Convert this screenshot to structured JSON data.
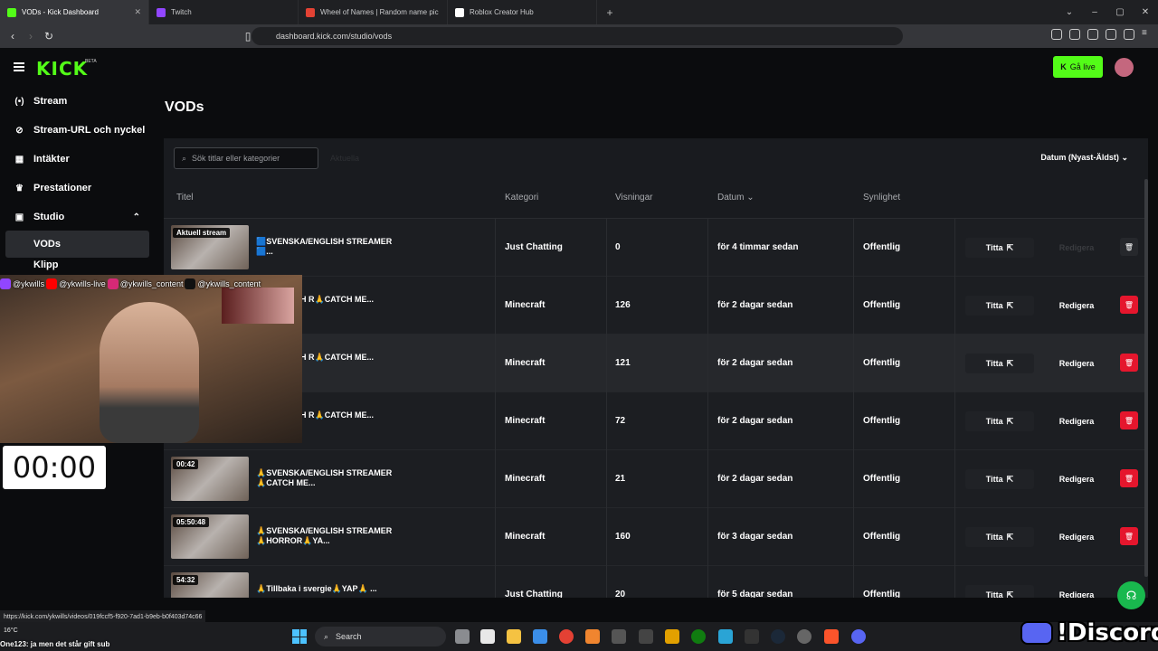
{
  "browser": {
    "tabs": [
      {
        "title": "VODs - Kick Dashboard",
        "active": true,
        "favicon_color": "#53fc18"
      },
      {
        "title": "Twitch",
        "active": false,
        "favicon_color": "#9146ff"
      },
      {
        "title": "Wheel of Names | Random name pic",
        "active": false,
        "favicon_color": "#e34234"
      },
      {
        "title": "Roblox Creator Hub",
        "active": false,
        "favicon_color": "#ffffff"
      }
    ],
    "close_glyph": "✕",
    "url": "dashboard.kick.com/studio/vods",
    "status_url": "https://kick.com/ykwills/videos/019fccf5-f920-7ad1-b9eb-b0f403d74c66"
  },
  "header": {
    "logo": "KICK",
    "beta": "BETA",
    "go_live_label": "Gå live",
    "accent_color": "#53fc18"
  },
  "sidebar": {
    "items": [
      {
        "label": "Stream",
        "icon": "broadcast-icon",
        "glyph": "(•)"
      },
      {
        "label": "Stream-URL och nyckel",
        "icon": "link-icon",
        "glyph": "⊘"
      },
      {
        "label": "Intäkter",
        "icon": "table-icon",
        "glyph": "▦"
      },
      {
        "label": "Prestationer",
        "icon": "trophy-icon",
        "glyph": "♛"
      },
      {
        "label": "Studio",
        "icon": "studio-icon",
        "glyph": "▣"
      },
      {
        "label": "VODs",
        "icon": "",
        "glyph": ""
      },
      {
        "label": "Klipp",
        "icon": "",
        "glyph": ""
      }
    ],
    "studio_chevron": "⌃"
  },
  "main": {
    "title": "VODs",
    "search_placeholder": "Sök titlar eller kategorier",
    "ghost_filter": "Aktuella",
    "sort_label": "Datum (Nyast-Äldst)",
    "columns": {
      "title": "Titel",
      "category": "Kategori",
      "views": "Visningar",
      "date": "Datum",
      "visibility": "Synlighet"
    },
    "watch_label": "Titta",
    "edit_label": "Redigera",
    "rows": [
      {
        "thumb_badge": "Aktuell stream",
        "title": "🟦SVENSKA/ENGLISH STREAMER🟦...",
        "category": "Just Chatting",
        "views": "0",
        "date": "för 4 timmar sedan",
        "visibility": "Offentlig",
        "editable": false
      },
      {
        "thumb_badge": "",
        "title": "KA/ENGLISH R🙏CATCH ME...",
        "category": "Minecraft",
        "views": "126",
        "date": "för 2 dagar sedan",
        "visibility": "Offentlig",
        "editable": true
      },
      {
        "thumb_badge": "",
        "title": "KA/ENGLISH R🙏CATCH ME...",
        "category": "Minecraft",
        "views": "121",
        "date": "för 2 dagar sedan",
        "visibility": "Offentlig",
        "editable": true
      },
      {
        "thumb_badge": "",
        "title": "KA/ENGLISH R🙏CATCH ME...",
        "category": "Minecraft",
        "views": "72",
        "date": "för 2 dagar sedan",
        "visibility": "Offentlig",
        "editable": true
      },
      {
        "thumb_badge": "00:42",
        "title": "🙏SVENSKA/ENGLISH STREAMER🙏CATCH ME...",
        "category": "Minecraft",
        "views": "21",
        "date": "för 2 dagar sedan",
        "visibility": "Offentlig",
        "editable": true
      },
      {
        "thumb_badge": "05:50:48",
        "title": "🙏SVENSKA/ENGLISH STREAMER🙏HORROR🙏YA...",
        "category": "Minecraft",
        "views": "160",
        "date": "för 3 dagar sedan",
        "visibility": "Offentlig",
        "editable": true
      },
      {
        "thumb_badge": "54:32",
        "title": "🙏Tillbaka i svergie🙏YAP🙏 ...",
        "category": "Just Chatting",
        "views": "20",
        "date": "för 5 dagar sedan",
        "visibility": "Offentlig",
        "editable": true
      }
    ]
  },
  "overlay": {
    "socials": [
      "@ykwills",
      "@ykwills-live",
      "@ykwills_content",
      "@ykwills_content"
    ],
    "timer": "00:00",
    "ticker": "One123: ja men det står gift sub",
    "discord": "!Discord"
  },
  "taskbar": {
    "temperature": "16°C",
    "search_label": "Search"
  }
}
